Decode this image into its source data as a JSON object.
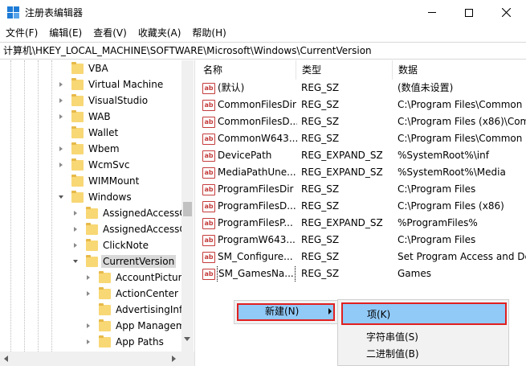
{
  "window": {
    "title": "注册表编辑器",
    "accent": "#1e7bd6"
  },
  "menu": [
    "文件(F)",
    "编辑(E)",
    "查看(V)",
    "收藏夹(A)",
    "帮助(H)"
  ],
  "address": "计算机\\HKEY_LOCAL_MACHINE\\SOFTWARE\\Microsoft\\Windows\\CurrentVersion",
  "tree": {
    "items": [
      {
        "label": "VBA",
        "level": 0,
        "state": "none"
      },
      {
        "label": "Virtual Machine",
        "level": 0,
        "state": "collapsed"
      },
      {
        "label": "VisualStudio",
        "level": 0,
        "state": "collapsed"
      },
      {
        "label": "WAB",
        "level": 0,
        "state": "collapsed"
      },
      {
        "label": "Wallet",
        "level": 0,
        "state": "none"
      },
      {
        "label": "Wbem",
        "level": 0,
        "state": "collapsed"
      },
      {
        "label": "WcmSvc",
        "level": 0,
        "state": "collapsed"
      },
      {
        "label": "WIMMount",
        "level": 0,
        "state": "none"
      },
      {
        "label": "Windows",
        "level": 0,
        "state": "expanded"
      },
      {
        "label": "AssignedAccessC",
        "level": 1,
        "state": "collapsed"
      },
      {
        "label": "AssignedAccessC",
        "level": 1,
        "state": "collapsed"
      },
      {
        "label": "ClickNote",
        "level": 1,
        "state": "collapsed"
      },
      {
        "label": "CurrentVersion",
        "level": 1,
        "state": "expanded",
        "selected": true
      },
      {
        "label": "AccountPicture",
        "level": 2,
        "state": "collapsed"
      },
      {
        "label": "ActionCenter",
        "level": 2,
        "state": "collapsed"
      },
      {
        "label": "AdvertisingInfo",
        "level": 2,
        "state": "none"
      },
      {
        "label": "App Managem",
        "level": 2,
        "state": "collapsed"
      },
      {
        "label": "App Paths",
        "level": 2,
        "state": "collapsed"
      }
    ]
  },
  "list": {
    "columns": [
      "名称",
      "类型",
      "数据"
    ],
    "rows": [
      {
        "name": "(默认)",
        "type": "REG_SZ",
        "data": "(数值未设置)"
      },
      {
        "name": "CommonFilesDir",
        "type": "REG_SZ",
        "data": "C:\\Program Files\\Common"
      },
      {
        "name": "CommonFilesD...",
        "type": "REG_SZ",
        "data": "C:\\Program Files (x86)\\Com"
      },
      {
        "name": "CommonW643...",
        "type": "REG_SZ",
        "data": "C:\\Program Files\\Common"
      },
      {
        "name": "DevicePath",
        "type": "REG_EXPAND_SZ",
        "data": "%SystemRoot%\\inf"
      },
      {
        "name": "MediaPathUne...",
        "type": "REG_EXPAND_SZ",
        "data": "%SystemRoot%\\Media"
      },
      {
        "name": "ProgramFilesDir",
        "type": "REG_SZ",
        "data": "C:\\Program Files"
      },
      {
        "name": "ProgramFilesD...",
        "type": "REG_SZ",
        "data": "C:\\Program Files (x86)"
      },
      {
        "name": "ProgramFilesP...",
        "type": "REG_EXPAND_SZ",
        "data": "%ProgramFiles%"
      },
      {
        "name": "ProgramW643...",
        "type": "REG_SZ",
        "data": "C:\\Program Files"
      },
      {
        "name": "SM_Configure...",
        "type": "REG_SZ",
        "data": "Set Program Access and De"
      },
      {
        "name": "SM_GamesNa...",
        "type": "REG_SZ",
        "data": "Games",
        "focused": true
      }
    ]
  },
  "context_menu": {
    "new_label": "新建(N)",
    "submenu": {
      "key": "项(K)",
      "string": "字符串值(S)",
      "binary": "二进制值(B)"
    },
    "highlight_color": "#91c9f7",
    "annotation_color": "#e02020"
  }
}
